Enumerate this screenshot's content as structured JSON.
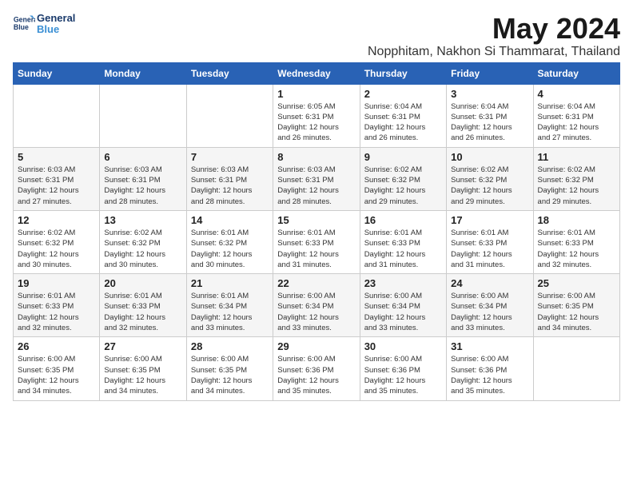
{
  "logo": {
    "line1": "General",
    "line2": "Blue"
  },
  "title": "May 2024",
  "location": "Nopphitam, Nakhon Si Thammarat, Thailand",
  "days_of_week": [
    "Sunday",
    "Monday",
    "Tuesday",
    "Wednesday",
    "Thursday",
    "Friday",
    "Saturday"
  ],
  "weeks": [
    [
      {
        "day": "",
        "info": ""
      },
      {
        "day": "",
        "info": ""
      },
      {
        "day": "",
        "info": ""
      },
      {
        "day": "1",
        "info": "Sunrise: 6:05 AM\nSunset: 6:31 PM\nDaylight: 12 hours\nand 26 minutes."
      },
      {
        "day": "2",
        "info": "Sunrise: 6:04 AM\nSunset: 6:31 PM\nDaylight: 12 hours\nand 26 minutes."
      },
      {
        "day": "3",
        "info": "Sunrise: 6:04 AM\nSunset: 6:31 PM\nDaylight: 12 hours\nand 26 minutes."
      },
      {
        "day": "4",
        "info": "Sunrise: 6:04 AM\nSunset: 6:31 PM\nDaylight: 12 hours\nand 27 minutes."
      }
    ],
    [
      {
        "day": "5",
        "info": "Sunrise: 6:03 AM\nSunset: 6:31 PM\nDaylight: 12 hours\nand 27 minutes."
      },
      {
        "day": "6",
        "info": "Sunrise: 6:03 AM\nSunset: 6:31 PM\nDaylight: 12 hours\nand 28 minutes."
      },
      {
        "day": "7",
        "info": "Sunrise: 6:03 AM\nSunset: 6:31 PM\nDaylight: 12 hours\nand 28 minutes."
      },
      {
        "day": "8",
        "info": "Sunrise: 6:03 AM\nSunset: 6:31 PM\nDaylight: 12 hours\nand 28 minutes."
      },
      {
        "day": "9",
        "info": "Sunrise: 6:02 AM\nSunset: 6:32 PM\nDaylight: 12 hours\nand 29 minutes."
      },
      {
        "day": "10",
        "info": "Sunrise: 6:02 AM\nSunset: 6:32 PM\nDaylight: 12 hours\nand 29 minutes."
      },
      {
        "day": "11",
        "info": "Sunrise: 6:02 AM\nSunset: 6:32 PM\nDaylight: 12 hours\nand 29 minutes."
      }
    ],
    [
      {
        "day": "12",
        "info": "Sunrise: 6:02 AM\nSunset: 6:32 PM\nDaylight: 12 hours\nand 30 minutes."
      },
      {
        "day": "13",
        "info": "Sunrise: 6:02 AM\nSunset: 6:32 PM\nDaylight: 12 hours\nand 30 minutes."
      },
      {
        "day": "14",
        "info": "Sunrise: 6:01 AM\nSunset: 6:32 PM\nDaylight: 12 hours\nand 30 minutes."
      },
      {
        "day": "15",
        "info": "Sunrise: 6:01 AM\nSunset: 6:33 PM\nDaylight: 12 hours\nand 31 minutes."
      },
      {
        "day": "16",
        "info": "Sunrise: 6:01 AM\nSunset: 6:33 PM\nDaylight: 12 hours\nand 31 minutes."
      },
      {
        "day": "17",
        "info": "Sunrise: 6:01 AM\nSunset: 6:33 PM\nDaylight: 12 hours\nand 31 minutes."
      },
      {
        "day": "18",
        "info": "Sunrise: 6:01 AM\nSunset: 6:33 PM\nDaylight: 12 hours\nand 32 minutes."
      }
    ],
    [
      {
        "day": "19",
        "info": "Sunrise: 6:01 AM\nSunset: 6:33 PM\nDaylight: 12 hours\nand 32 minutes."
      },
      {
        "day": "20",
        "info": "Sunrise: 6:01 AM\nSunset: 6:33 PM\nDaylight: 12 hours\nand 32 minutes."
      },
      {
        "day": "21",
        "info": "Sunrise: 6:01 AM\nSunset: 6:34 PM\nDaylight: 12 hours\nand 33 minutes."
      },
      {
        "day": "22",
        "info": "Sunrise: 6:00 AM\nSunset: 6:34 PM\nDaylight: 12 hours\nand 33 minutes."
      },
      {
        "day": "23",
        "info": "Sunrise: 6:00 AM\nSunset: 6:34 PM\nDaylight: 12 hours\nand 33 minutes."
      },
      {
        "day": "24",
        "info": "Sunrise: 6:00 AM\nSunset: 6:34 PM\nDaylight: 12 hours\nand 33 minutes."
      },
      {
        "day": "25",
        "info": "Sunrise: 6:00 AM\nSunset: 6:35 PM\nDaylight: 12 hours\nand 34 minutes."
      }
    ],
    [
      {
        "day": "26",
        "info": "Sunrise: 6:00 AM\nSunset: 6:35 PM\nDaylight: 12 hours\nand 34 minutes."
      },
      {
        "day": "27",
        "info": "Sunrise: 6:00 AM\nSunset: 6:35 PM\nDaylight: 12 hours\nand 34 minutes."
      },
      {
        "day": "28",
        "info": "Sunrise: 6:00 AM\nSunset: 6:35 PM\nDaylight: 12 hours\nand 34 minutes."
      },
      {
        "day": "29",
        "info": "Sunrise: 6:00 AM\nSunset: 6:36 PM\nDaylight: 12 hours\nand 35 minutes."
      },
      {
        "day": "30",
        "info": "Sunrise: 6:00 AM\nSunset: 6:36 PM\nDaylight: 12 hours\nand 35 minutes."
      },
      {
        "day": "31",
        "info": "Sunrise: 6:00 AM\nSunset: 6:36 PM\nDaylight: 12 hours\nand 35 minutes."
      },
      {
        "day": "",
        "info": ""
      }
    ]
  ]
}
